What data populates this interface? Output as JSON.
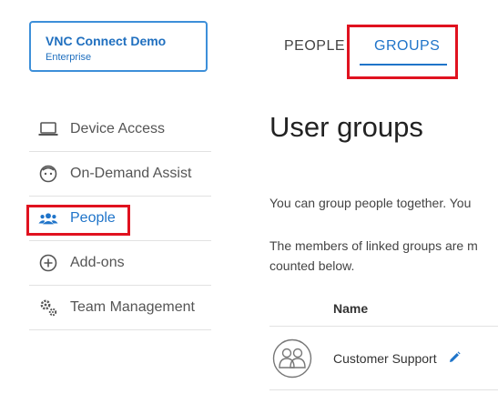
{
  "team": {
    "name": "VNC Connect Demo",
    "plan": "Enterprise"
  },
  "sidebar": {
    "items": [
      {
        "label": "Device Access",
        "icon": "laptop-icon"
      },
      {
        "label": "On-Demand Assist",
        "icon": "face-icon"
      },
      {
        "label": "People",
        "icon": "people-icon",
        "active": true
      },
      {
        "label": "Add-ons",
        "icon": "plus-circle-icon"
      },
      {
        "label": "Team Management",
        "icon": "gears-icon"
      }
    ]
  },
  "tabs": [
    {
      "label": "PEOPLE"
    },
    {
      "label": "GROUPS",
      "active": true
    }
  ],
  "main": {
    "title": "User groups",
    "intro": "You can group people together. You",
    "linked_line1": "The members of linked groups are m",
    "linked_line2": "counted below.",
    "table": {
      "name_header": "Name",
      "rows": [
        {
          "name": "Customer Support",
          "icon": "group-avatar-icon"
        }
      ]
    }
  },
  "colors": {
    "accent": "#1f74c9",
    "highlight": "#e0121f",
    "card_border": "#3d8fd9"
  }
}
